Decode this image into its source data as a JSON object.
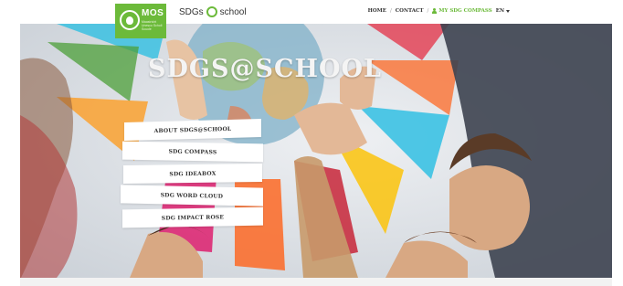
{
  "header": {
    "logo": {
      "name": "MOS",
      "subtitle": "Maastricht Unesco Scholl Scuole"
    },
    "brand": {
      "prefix": "SDGs",
      "suffix": "school"
    },
    "nav": {
      "home": "HOME",
      "sep1": "/",
      "contact": "CONTACT",
      "sep2": "/",
      "my_compass": "MY SDG COMPASS",
      "language": "EN",
      "user_icon": "user-icon",
      "language_icon": "chevron-down-icon"
    }
  },
  "hero": {
    "title": "SDGS@SCHOOL",
    "menu": [
      "ABOUT SDGS@SCHOOL",
      "SDG COMPASS",
      "SDG IDEABOX",
      "SDG WORD CLOUD",
      "SDG IMPACT ROSE"
    ]
  },
  "colors": {
    "accent_green": "#6cba3a",
    "wedge_red": "#e5243b",
    "wedge_yellow": "#fcc30b",
    "wedge_blue": "#26bde2",
    "wedge_orange": "#fd6925",
    "wedge_magenta": "#dd1367",
    "wedge_green": "#4c9f38"
  }
}
